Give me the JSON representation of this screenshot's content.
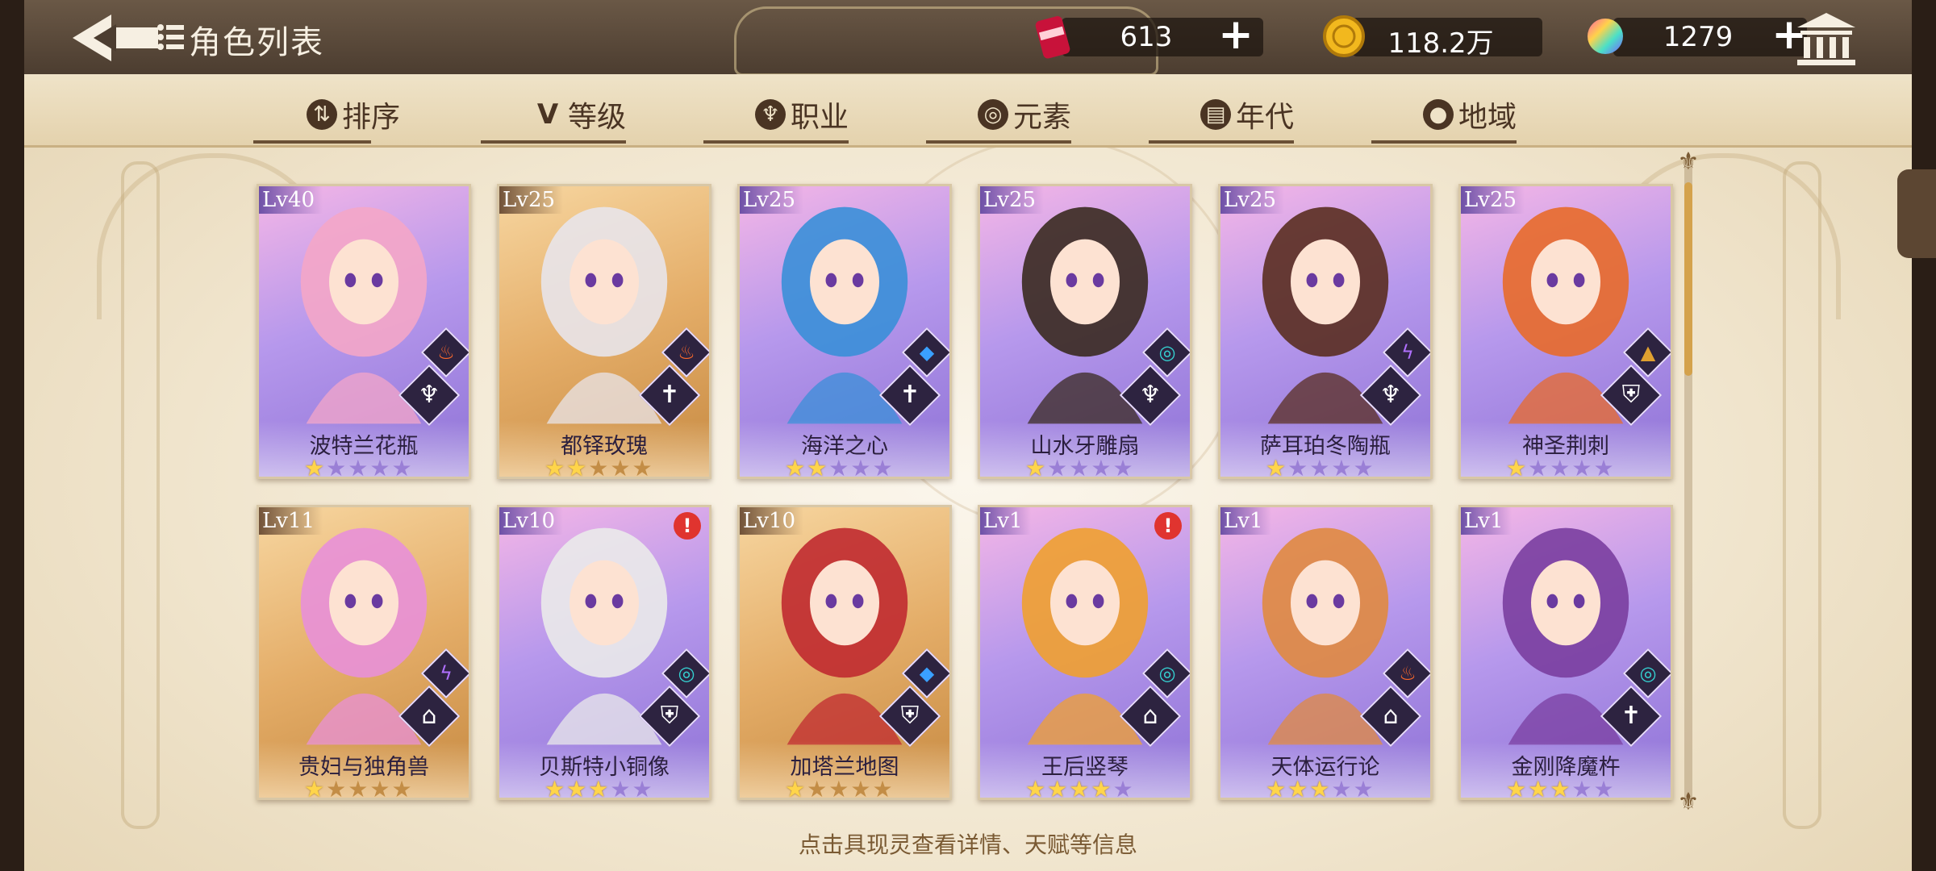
{
  "header": {
    "title": "角色列表",
    "resources": [
      {
        "name": "stamina",
        "icon": "energy-can-icon",
        "value": "613"
      },
      {
        "name": "gold",
        "icon": "gold-coin-icon",
        "value": "118.2万"
      },
      {
        "name": "gems",
        "icon": "rainbow-gem-icon",
        "value": "1279"
      }
    ]
  },
  "filters": [
    {
      "label": "排序",
      "icon": "sort-icon",
      "glyph": "⇅"
    },
    {
      "label": "等级",
      "icon": "level-v-icon",
      "glyph": "V"
    },
    {
      "label": "职业",
      "icon": "class-icon",
      "glyph": "♆"
    },
    {
      "label": "元素",
      "icon": "element-swirl-icon",
      "glyph": "◎"
    },
    {
      "label": "年代",
      "icon": "era-icon",
      "glyph": "▤"
    },
    {
      "label": "地域",
      "icon": "location-pin-icon",
      "glyph": "●"
    }
  ],
  "cards": [
    {
      "level": "Lv40",
      "name": "波特兰花瓶",
      "stars": 1,
      "max_stars": 5,
      "frame": "purple",
      "element": "fire",
      "class": "trident",
      "alert": false
    },
    {
      "level": "Lv25",
      "name": "都铎玫瑰",
      "stars": 2,
      "max_stars": 5,
      "frame": "gold",
      "element": "fire",
      "class": "sword",
      "alert": false
    },
    {
      "level": "Lv25",
      "name": "海洋之心",
      "stars": 2,
      "max_stars": 5,
      "frame": "purple",
      "element": "water",
      "class": "sword",
      "alert": false
    },
    {
      "level": "Lv25",
      "name": "山水牙雕扇",
      "stars": 1,
      "max_stars": 5,
      "frame": "purple",
      "element": "wind",
      "class": "trident",
      "alert": false
    },
    {
      "level": "Lv25",
      "name": "萨耳珀冬陶瓶",
      "stars": 1,
      "max_stars": 5,
      "frame": "purple",
      "element": "thunder",
      "class": "trident",
      "alert": false
    },
    {
      "level": "Lv25",
      "name": "神圣荆刺",
      "stars": 1,
      "max_stars": 5,
      "frame": "purple",
      "element": "earth",
      "class": "shield",
      "alert": false
    },
    {
      "level": "Lv11",
      "name": "贵妇与独角兽",
      "stars": 1,
      "max_stars": 5,
      "frame": "gold",
      "element": "thunder",
      "class": "book",
      "alert": false
    },
    {
      "level": "Lv10",
      "name": "贝斯特小铜像",
      "stars": 3,
      "max_stars": 5,
      "frame": "purple",
      "element": "wind",
      "class": "shield",
      "alert": true
    },
    {
      "level": "Lv10",
      "name": "加塔兰地图",
      "stars": 1,
      "max_stars": 5,
      "frame": "gold",
      "element": "water",
      "class": "shield",
      "alert": false
    },
    {
      "level": "Lv1",
      "name": "王后竖琴",
      "stars": 4,
      "max_stars": 5,
      "frame": "purple",
      "element": "wind",
      "class": "book",
      "alert": true
    },
    {
      "level": "Lv1",
      "name": "天体运行论",
      "stars": 3,
      "max_stars": 5,
      "frame": "purple",
      "element": "fire",
      "class": "book",
      "alert": false
    },
    {
      "level": "Lv1",
      "name": "金刚降魔杵",
      "stars": 3,
      "max_stars": 5,
      "frame": "purple",
      "element": "wind",
      "class": "sword",
      "alert": false
    }
  ],
  "hint": "点击具现灵查看详情、天赋等信息",
  "colors": {
    "fire": "#ff6a2a",
    "water": "#3aa0ff",
    "wind": "#35d0d0",
    "thunder": "#b070ff",
    "earth": "#e0a030",
    "star_on": "#ffd54a"
  }
}
